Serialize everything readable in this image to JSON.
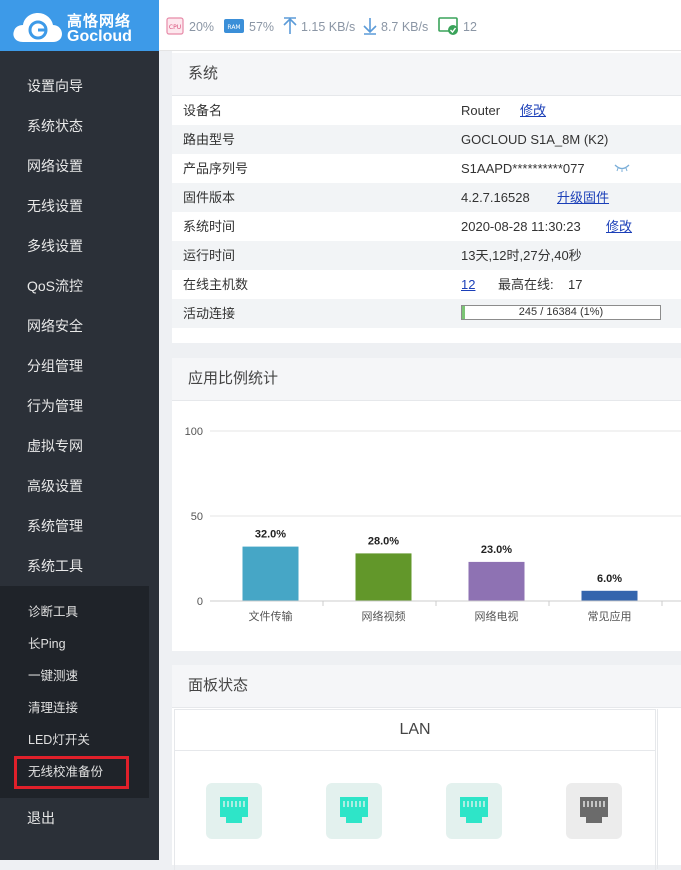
{
  "logo": {
    "cn": "高恪网络",
    "en": "Gocloud"
  },
  "topbar": {
    "cpu_label": "CPU",
    "cpu": "20%",
    "ram_label": "RAM",
    "ram": "57%",
    "upload": "1.15 KB/s",
    "download": "8.7 KB/s",
    "hosts": "12"
  },
  "menu": [
    "设置向导",
    "系统状态",
    "网络设置",
    "无线设置",
    "多线设置",
    "QoS流控",
    "网络安全",
    "分组管理",
    "行为管理",
    "虚拟专网",
    "高级设置",
    "系统管理",
    "系统工具"
  ],
  "submenu": [
    "诊断工具",
    "长Ping",
    "一键测速",
    "清理连接",
    "LED灯开关",
    "无线校准备份"
  ],
  "logout": "退出",
  "system": {
    "title": "系统",
    "rows": [
      {
        "k": "设备名",
        "v": "Router",
        "link": "修改"
      },
      {
        "k": "路由型号",
        "v": "GOCLOUD S1A_8M (K2)"
      },
      {
        "k": "产品序列号",
        "v": "S1AAPD**********077"
      },
      {
        "k": "固件版本",
        "v": "4.2.7.16528",
        "link": "升级固件"
      },
      {
        "k": "系统时间",
        "v": "2020-08-28 11:30:23",
        "link": "修改"
      },
      {
        "k": "运行时间",
        "v": "13天,12时,27分,40秒"
      },
      {
        "k": "在线主机数",
        "v": "12",
        "extra_label": "最高在线:",
        "extra": "17"
      },
      {
        "k": "活动连接",
        "progress_text": "245 / 16384 (1%)",
        "progress_fraction": 0.015
      }
    ]
  },
  "app_stats": {
    "title": "应用比例统计"
  },
  "chart_data": {
    "type": "bar",
    "categories": [
      "文件传输",
      "网络视频",
      "网络电视",
      "常见应用"
    ],
    "values": [
      32.0,
      28.0,
      23.0,
      6.0
    ],
    "labels": [
      "32.0%",
      "28.0%",
      "23.0%",
      "6.0%"
    ],
    "colors": [
      "#46a6c6",
      "#62972a",
      "#8e72b3",
      "#3465ad"
    ],
    "ylim": [
      0,
      100
    ],
    "yticks": [
      0,
      50,
      100
    ],
    "grid": true
  },
  "panel_status": {
    "title": "面板状态",
    "lan_label": "LAN",
    "ports": [
      {
        "name": "lan-port-1",
        "active": true
      },
      {
        "name": "lan-port-2",
        "active": true
      },
      {
        "name": "lan-port-3",
        "active": true
      },
      {
        "name": "lan-port-4",
        "active": false
      }
    ]
  },
  "colors": {
    "sidebar": "#2b3038",
    "logo_bg": "#3d9ae8",
    "link": "#1b3fb8",
    "port_active": "#2ee5c8",
    "port_inactive": "#6b6b6b",
    "highlight_box": "#e0202a"
  }
}
